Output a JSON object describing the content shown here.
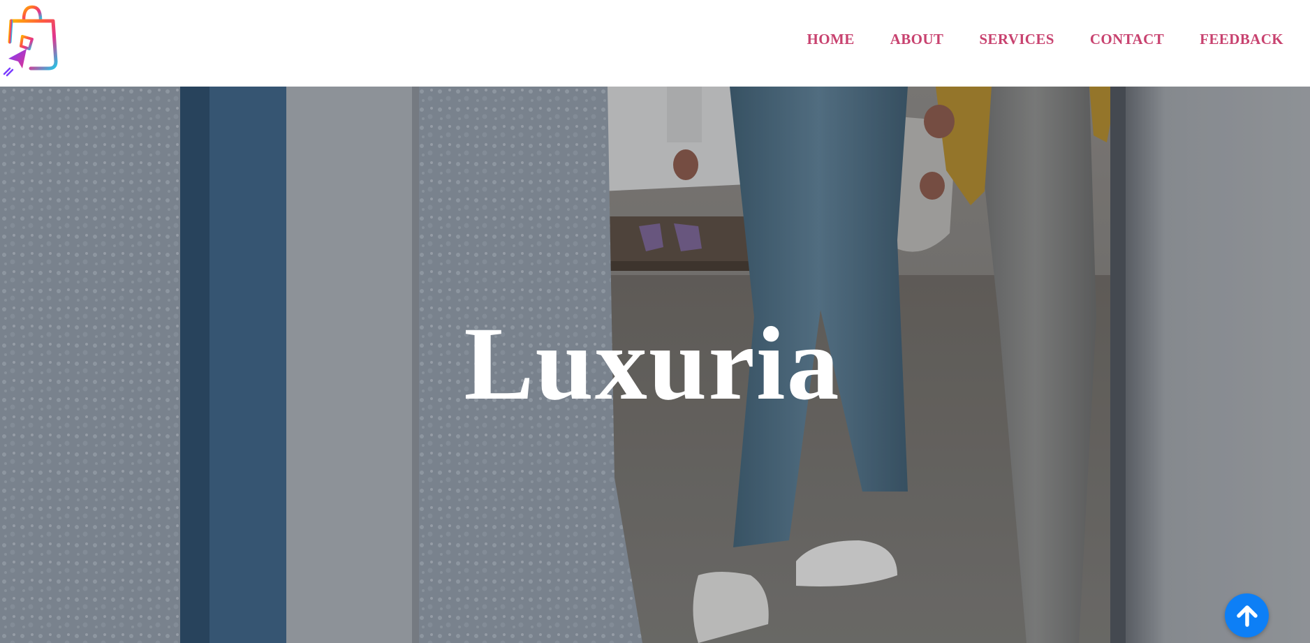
{
  "nav": {
    "logo_icon": "shopping-bag-cursor-icon",
    "links": [
      {
        "label": "HOME"
      },
      {
        "label": "ABOUT"
      },
      {
        "label": "SERVICES"
      },
      {
        "label": "CONTACT"
      },
      {
        "label": "FEEDBACK"
      }
    ],
    "link_color": "#c8426f"
  },
  "hero": {
    "title": "Luxuria"
  },
  "scroll_top": {
    "icon": "arrow-up-icon",
    "color": "#0d7ff6"
  }
}
